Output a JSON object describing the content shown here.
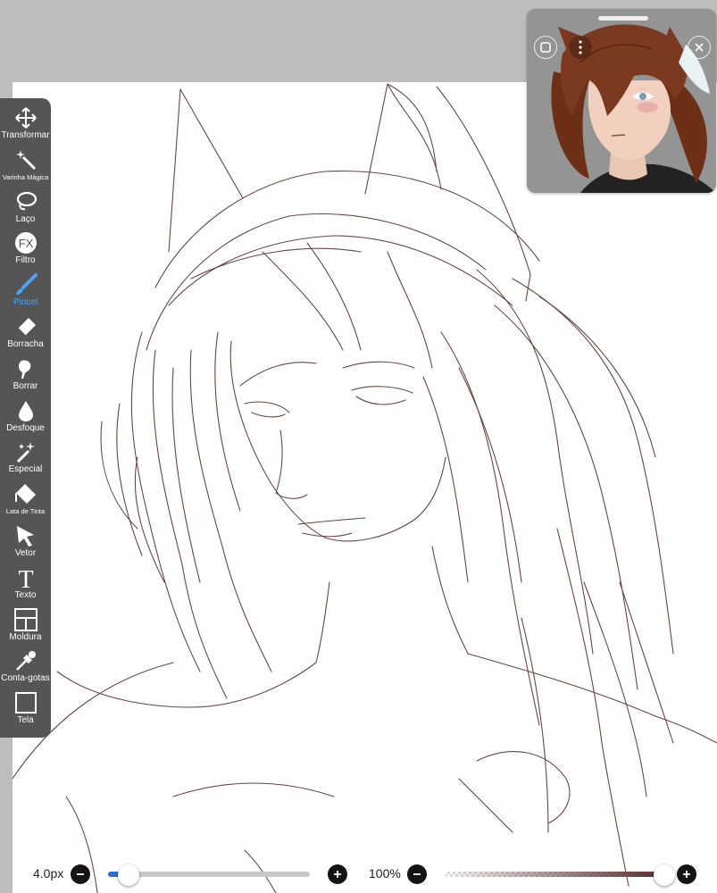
{
  "app": "ibisPaint",
  "tools": [
    {
      "label": "Transformar",
      "icon": "move-arrows-icon"
    },
    {
      "label": "Varinha Mágica",
      "icon": "magic-wand-icon"
    },
    {
      "label": "Laço",
      "icon": "lasso-icon"
    },
    {
      "label": "Filtro",
      "icon": "filter-fx-icon"
    },
    {
      "label": "Pincel",
      "icon": "brush-icon",
      "active": true
    },
    {
      "label": "Borracha",
      "icon": "eraser-icon"
    },
    {
      "label": "Borrar",
      "icon": "smudge-icon"
    },
    {
      "label": "Desfoque",
      "icon": "blur-drop-icon"
    },
    {
      "label": "Especial",
      "icon": "special-sparkle-icon"
    },
    {
      "label": "Lata de Tinta",
      "icon": "paint-bucket-icon"
    },
    {
      "label": "Vetor",
      "icon": "vector-cursor-icon"
    },
    {
      "label": "Texto",
      "icon": "text-t-icon"
    },
    {
      "label": "Moldura",
      "icon": "frame-icon"
    },
    {
      "label": "Conta-gotas",
      "icon": "eyedropper-icon"
    },
    {
      "label": "Tela",
      "icon": "canvas-icon"
    }
  ],
  "bottom_bar": {
    "brush_size": "4.0px",
    "brush_size_level": 0.1,
    "opacity": "100%",
    "opacity_level": 1.0,
    "brush_color": "#5a2a2a"
  },
  "fx_text": "FX",
  "text_tool_glyph": "T",
  "colors": {
    "toolbar": "#555555",
    "active": "#4aa3ff",
    "canvas_bg": "#bdbdbd",
    "sketch": "#6b4545"
  }
}
